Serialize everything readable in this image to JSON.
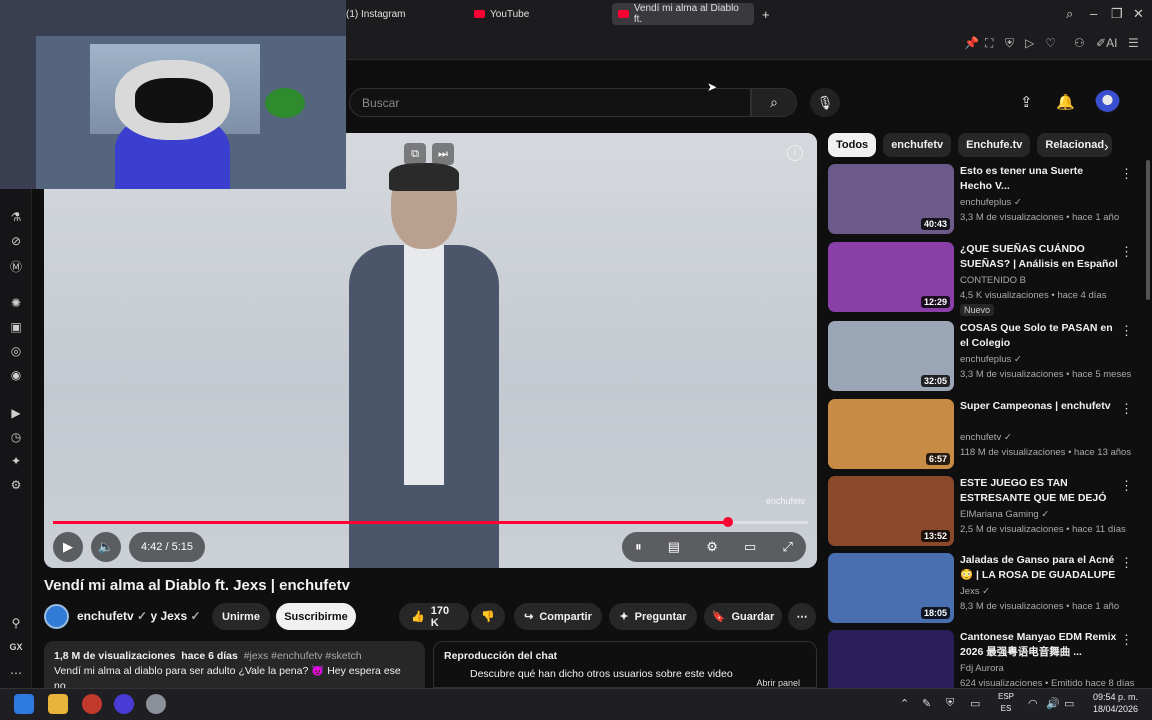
{
  "browser": {
    "tabs": [
      {
        "label": "(1) Instagram",
        "active": false
      },
      {
        "label": "YouTube",
        "active": false
      },
      {
        "label": "Vendí mi alma al Diablo ft.",
        "active": true
      }
    ],
    "new_tab": "+",
    "toolbar_ai_label": "AI"
  },
  "left_rail": {
    "footer_label": "GX"
  },
  "header": {
    "search_placeholder": "Buscar",
    "icons": [
      "search-icon",
      "mic-icon",
      "upload-icon",
      "bell-icon",
      "avatar"
    ]
  },
  "player": {
    "time_current": "4:42",
    "time_total": "5:15",
    "time_text": "4:42 / 5:15",
    "progress_fraction": 0.894,
    "watermark": "enchufetv",
    "accent_color": "#ff0033"
  },
  "video": {
    "title": "Vendí mi alma al Diablo ft. Jexs | enchufetv",
    "channels": "enchufetv",
    "and_label": "y Jexs",
    "join_label": "Unirme",
    "subscribe_label": "Suscribirme",
    "likes": "170 K",
    "share_label": "Compartir",
    "ask_label": "Preguntar",
    "save_label": "Guardar",
    "views": "1,8 M de visualizaciones",
    "age": "hace 6 días",
    "hashtags": "#jexs #enchufetv #sketch",
    "description": "Vendí mi alma al diablo para ser adulto ¿Vale la pena? 😈 Hey espera ese no"
  },
  "chat_replay": {
    "title": "Reproducción del chat",
    "text": "Descubre qué han dicho otros usuarios sobre este video",
    "open_label": "Abrir panel"
  },
  "chips": [
    "Todos",
    "enchufetv",
    "Enchufe.tv",
    "Relacionad"
  ],
  "recommendations": [
    {
      "title": "Esto es tener una Suerte Hecho V...",
      "channel": "enchufeplus",
      "verified": true,
      "meta": "3,3 M de visualizaciones • hace 1 año",
      "duration": "40:43",
      "thumb": "#6b5a8a"
    },
    {
      "title": "¿QUE SUEÑAS CUÁNDO SUEÑAS? | Análisis en Español",
      "channel": "CONTENIDO B",
      "verified": false,
      "meta": "4,5 K visualizaciones • hace 4 días",
      "duration": "12:29",
      "badge": "Nuevo",
      "thumb": "#8a3fa8"
    },
    {
      "title": "COSAS Que Solo te PASAN en el Colegio",
      "channel": "enchufeplus",
      "verified": true,
      "meta": "3,3 M de visualizaciones • hace 5 meses",
      "duration": "32:05",
      "thumb": "#9aa6b5"
    },
    {
      "title": "Super Campeonas | enchufetv",
      "channel": "enchufetv",
      "verified": true,
      "meta": "118 M de visualizaciones • hace 13 años",
      "duration": "6:57",
      "thumb": "#c78b45"
    },
    {
      "title": "ESTE JUEGO ES TAN ESTRESANTE QUE ME DEJÓ ...",
      "channel": "ElMariana Gaming",
      "verified": true,
      "meta": "2,5 M de visualizaciones • hace 11 días",
      "duration": "13:52",
      "thumb": "#8a4a2a"
    },
    {
      "title": "Jaladas de Ganso para el Acné 😳 | LA ROSA DE GUADALUPE",
      "channel": "Jexs",
      "verified": true,
      "meta": "8,3 M de visualizaciones • hace 1 año",
      "duration": "18:05",
      "thumb": "#4a6fb0"
    },
    {
      "title": "Cantonese Manyao EDM Remix 2026 最强粤语电音舞曲 ...",
      "channel": "Fdj Aurora",
      "verified": false,
      "meta": "624 visualizaciones • Emitido hace 8 días",
      "duration": "",
      "thumb": "#2a1f5a"
    }
  ],
  "taskbar": {
    "lang_top": "ESP",
    "lang_bottom": "ES",
    "time": "09:54 p. m.",
    "date": "18/04/2026"
  }
}
